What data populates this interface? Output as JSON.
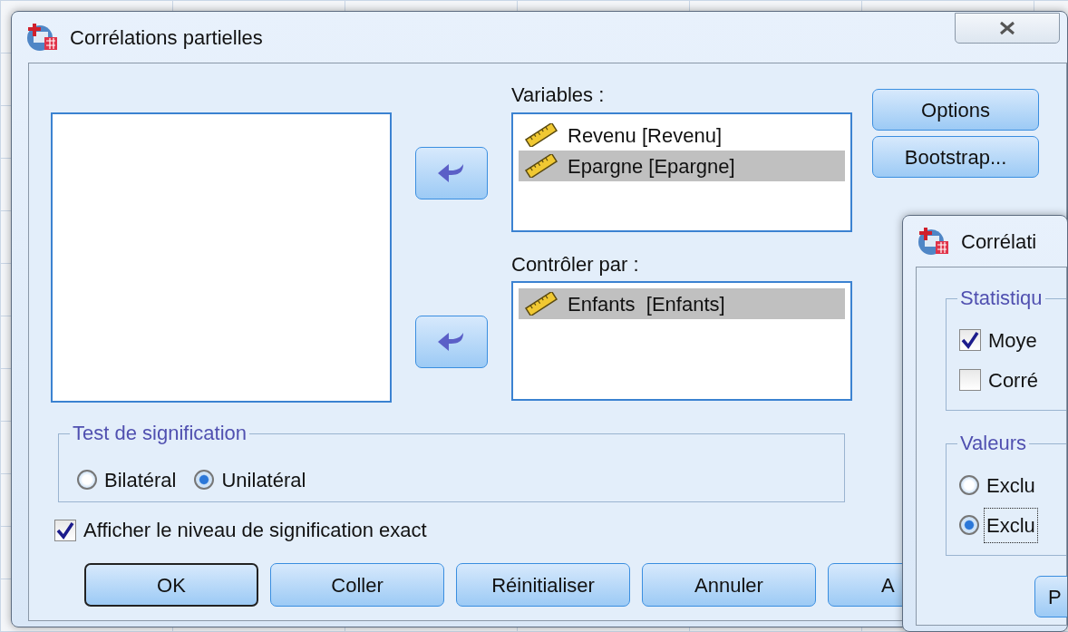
{
  "window": {
    "title": "Corrélations partielles"
  },
  "variables": {
    "label": "Variables :",
    "items": [
      {
        "text": "Revenu [Revenu]",
        "selected": false
      },
      {
        "text": "Epargne [Epargne]",
        "selected": true
      }
    ]
  },
  "control": {
    "label": "Contrôler par :",
    "items": [
      {
        "text": "Enfants  [Enfants]",
        "selected": true
      }
    ]
  },
  "side_buttons": [
    "Options",
    "Bootstrap..."
  ],
  "significance": {
    "title": "Test de signification",
    "options": [
      {
        "label": "Bilatéral",
        "selected": false
      },
      {
        "label": "Unilatéral",
        "selected": true
      }
    ]
  },
  "exact_checkbox": {
    "label": "Afficher le niveau de signification exact",
    "checked": true
  },
  "buttons": [
    {
      "label": "OK",
      "default": true
    },
    {
      "label": "Coller",
      "default": false
    },
    {
      "label": "Réinitialiser",
      "default": false
    },
    {
      "label": "Annuler",
      "default": false
    },
    {
      "label": "A",
      "default": false
    }
  ],
  "options_dialog": {
    "title": "Corrélati",
    "groups": [
      {
        "title": "Statistiqu",
        "items": [
          {
            "kind": "checkbox",
            "label": "Moye",
            "checked": true,
            "focused": false
          },
          {
            "kind": "checkbox",
            "label": "Corré",
            "checked": false,
            "focused": false
          }
        ]
      },
      {
        "title": "Valeurs",
        "items": [
          {
            "kind": "radio",
            "label": "Exclu",
            "checked": false,
            "focused": false
          },
          {
            "kind": "radio",
            "label": "Exclu",
            "checked": true,
            "focused": true
          }
        ]
      }
    ],
    "buttons": [
      "P"
    ]
  }
}
